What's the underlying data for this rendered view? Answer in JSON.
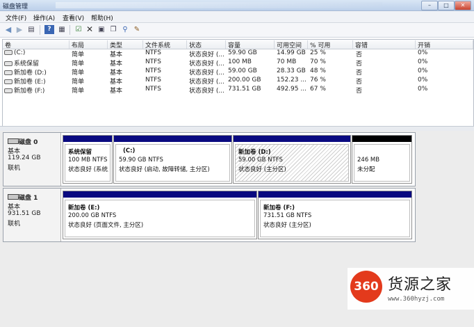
{
  "window": {
    "title": "磁盘管理"
  },
  "menu": [
    "文件(F)",
    "操作(A)",
    "查看(V)",
    "帮助(H)"
  ],
  "toolbar_icons": [
    "back-icon",
    "forward-icon",
    "panel-icon",
    "help-icon",
    "list-icon",
    "properties-icon",
    "delete-icon",
    "open-icon",
    "copy-icon",
    "search-icon",
    "help-book-icon"
  ],
  "table": {
    "headers": [
      "卷",
      "布局",
      "类型",
      "文件系统",
      "状态",
      "容量",
      "可用空间",
      "% 可用",
      "容错",
      "开销"
    ],
    "rows": [
      [
        "(C:)",
        "简单",
        "基本",
        "NTFS",
        "状态良好 (...",
        "59.90 GB",
        "14.99 GB",
        "25 %",
        "否",
        "0%"
      ],
      [
        "系统保留",
        "简单",
        "基本",
        "NTFS",
        "状态良好 (...",
        "100 MB",
        "70 MB",
        "70 %",
        "否",
        "0%"
      ],
      [
        "新加卷 (D:)",
        "简单",
        "基本",
        "NTFS",
        "状态良好 (...",
        "59.00 GB",
        "28.33 GB",
        "48 %",
        "否",
        "0%"
      ],
      [
        "新加卷 (E:)",
        "简单",
        "基本",
        "NTFS",
        "状态良好 (...",
        "200.00 GB",
        "152.23 ...",
        "76 %",
        "否",
        "0%"
      ],
      [
        "新加卷 (F:)",
        "简单",
        "基本",
        "NTFS",
        "状态良好 (...",
        "731.51 GB",
        "492.95 ...",
        "67 %",
        "否",
        "0%"
      ]
    ]
  },
  "disks": [
    {
      "name": "磁盘 0",
      "type": "基本",
      "size": "119.24 GB",
      "status": "联机",
      "partitions": [
        {
          "title": "系统保留",
          "size_fs": "100 MB NTFS",
          "status": "状态良好 (系统,",
          "style": "primary"
        },
        {
          "title": "(C:)",
          "size_fs": "59.90 GB NTFS",
          "status": "状态良好 (启动, 故障转储, 主分区)",
          "style": "primary"
        },
        {
          "title": "新加卷 (D:)",
          "size_fs": "59.00 GB NTFS",
          "status": "状态良好 (主分区)",
          "style": "selected"
        },
        {
          "title": "",
          "size_fs": "246 MB",
          "status": "未分配",
          "style": "unallocated"
        }
      ]
    },
    {
      "name": "磁盘 1",
      "type": "基本",
      "size": "931.51 GB",
      "status": "联机",
      "partitions": [
        {
          "title": "新加卷 (E:)",
          "size_fs": "200.00 GB NTFS",
          "status": "状态良好 (页面文件, 主分区)",
          "style": "primary"
        },
        {
          "title": "新加卷 (F:)",
          "size_fs": "731.51 GB NTFS",
          "status": "状态良好 (主分区)",
          "style": "primary"
        }
      ]
    }
  ],
  "watermark": {
    "logo_text": "360",
    "brand": "货源之家",
    "url": "www.360hyzj.com"
  },
  "colors": {
    "primary_band": "#0a0a80",
    "unallocated_band": "#000000",
    "logo_red": "#e33a1c"
  }
}
